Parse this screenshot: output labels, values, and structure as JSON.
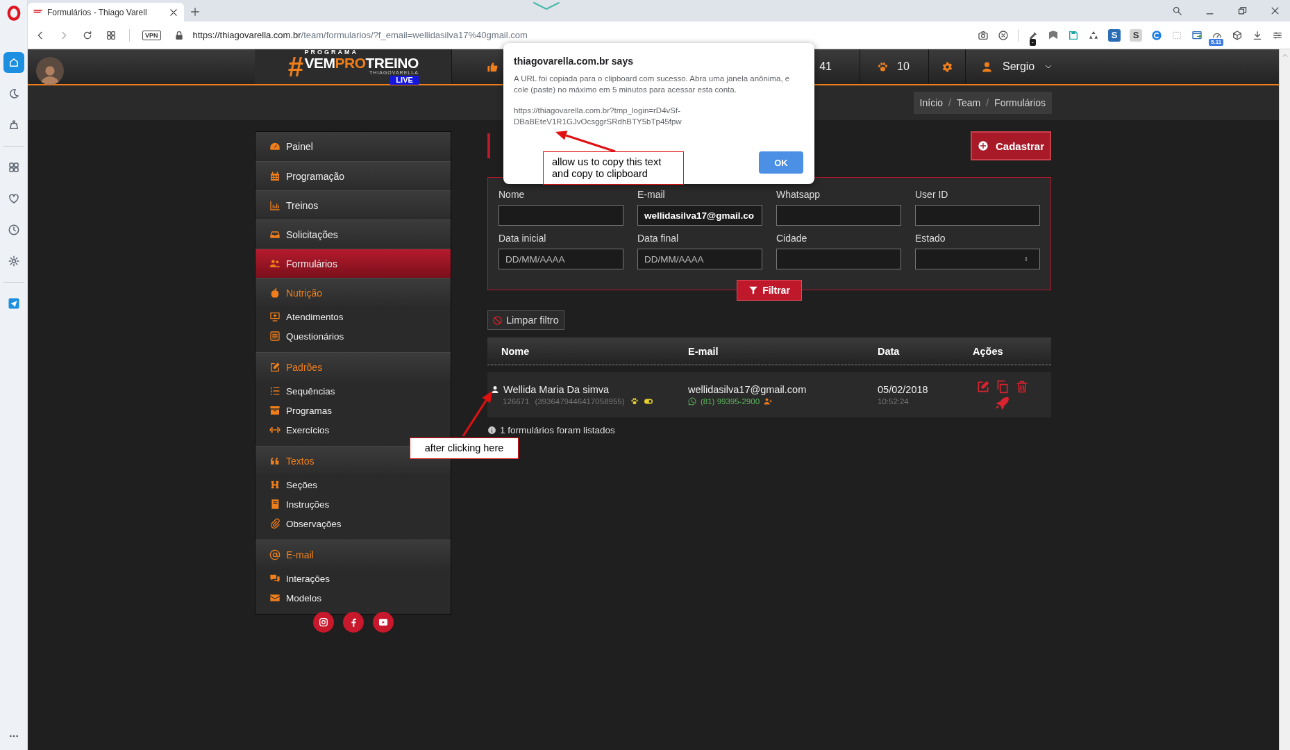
{
  "browser": {
    "tabs": [
      {
        "title": "Formulários - Thiago Varell",
        "selected": true
      }
    ],
    "side_panel": {
      "groups": [
        {
          "items": [
            {
              "kind": "home",
              "selected": true
            },
            {
              "kind": "crescent",
              "selected": false
            },
            {
              "kind": "bag",
              "selected": false
            }
          ]
        },
        {
          "items": [
            {
              "kind": "grid",
              "selected": false
            },
            {
              "kind": "heart",
              "selected": false
            },
            {
              "kind": "clock",
              "selected": false
            },
            {
              "kind": "settings",
              "selected": false
            }
          ]
        },
        {
          "items": [
            {
              "kind": "send",
              "selected": false
            }
          ]
        }
      ]
    },
    "vpn_badge": "VPN",
    "url": {
      "host": "https://thiagovarella.com.br",
      "path": "/team/formularios/?f_email=wellidasilva17%40gmail.com"
    },
    "extensions": [
      {
        "kind": "camera"
      },
      {
        "kind": "blocker"
      },
      {
        "kind": "eyedropper",
        "badge": "-"
      },
      {
        "kind": "bookmark"
      },
      {
        "kind": "floppy"
      },
      {
        "kind": "recycle"
      },
      {
        "kind": "letter",
        "label": "S",
        "color": "#2a6db5"
      },
      {
        "kind": "letter",
        "label": "S",
        "color": "#d4d4d4"
      },
      {
        "kind": "refresh"
      },
      {
        "kind": "snapshot"
      },
      {
        "kind": "window"
      },
      {
        "kind": "speed",
        "badge": "5.11"
      },
      {
        "kind": "cube"
      },
      {
        "kind": "download"
      },
      {
        "kind": "easy_setup"
      }
    ]
  },
  "header": {
    "logo": {
      "kicker": "PROGRAMA",
      "hash": "#",
      "words": [
        {
          "text": "VEM",
          "color": "#ffffff"
        },
        {
          "text": "PRO",
          "color": "#f07f1b"
        },
        {
          "text": "TREINO",
          "color": "#ffffff"
        }
      ],
      "byline": "THIAGOVARELLA",
      "badge": "LIVE"
    },
    "stats": [
      {
        "kind": "likes",
        "value": "41"
      },
      {
        "kind": "paw",
        "value": "10"
      }
    ],
    "user": {
      "name": "Sergio"
    }
  },
  "breadcrumb": [
    {
      "kind": "link",
      "text": "Início"
    },
    {
      "kind": "separator",
      "text": "/"
    },
    {
      "kind": "link",
      "text": "Team"
    },
    {
      "kind": "separator",
      "text": "/"
    },
    {
      "kind": "current",
      "text": "Formulários"
    }
  ],
  "sidebar": {
    "items": [
      {
        "label": "Painel",
        "kind": "link",
        "selected": false
      },
      {
        "label": "Programação",
        "kind": "link",
        "selected": false
      },
      {
        "label": "Treinos",
        "kind": "link",
        "selected": false
      },
      {
        "label": "Solicitações",
        "kind": "link",
        "selected": false
      },
      {
        "label": "Formulários",
        "kind": "link",
        "selected": true
      },
      {
        "label": "Nutrição",
        "kind": "group",
        "selected": false,
        "children": [
          {
            "label": "Atendimentos",
            "selected": false
          },
          {
            "label": "Questionários",
            "selected": false
          }
        ]
      },
      {
        "label": "Padrões",
        "kind": "group",
        "selected": false,
        "children": [
          {
            "label": "Sequências",
            "selected": false
          },
          {
            "label": "Programas",
            "selected": false
          },
          {
            "label": "Exercícios",
            "selected": false
          }
        ]
      },
      {
        "label": "Textos",
        "kind": "group",
        "selected": false,
        "children": [
          {
            "label": "Seções",
            "selected": false
          },
          {
            "label": "Instruções",
            "selected": false
          },
          {
            "label": "Observações",
            "selected": false
          }
        ]
      },
      {
        "label": "E-mail",
        "kind": "group",
        "selected": false,
        "children": [
          {
            "label": "Interações",
            "selected": false
          },
          {
            "label": "Modelos",
            "selected": false
          }
        ]
      }
    ],
    "social": [
      {
        "kind": "instagram"
      },
      {
        "kind": "facebook"
      },
      {
        "kind": "youtube"
      }
    ]
  },
  "cadastrar_button": "Cadastrar",
  "filters": [
    {
      "label": "Nome",
      "kind": "text"
    },
    {
      "label": "E-mail",
      "kind": "text",
      "value": "wellidasilva17@gmail.co"
    },
    {
      "label": "Whatsapp",
      "kind": "text"
    },
    {
      "label": "User ID",
      "kind": "text"
    },
    {
      "label": "Data inicial",
      "kind": "text",
      "placeholder": "DD/MM/AAAA"
    },
    {
      "label": "Data final",
      "kind": "text",
      "placeholder": "DD/MM/AAAA"
    },
    {
      "label": "Cidade",
      "kind": "text"
    },
    {
      "label": "Estado",
      "kind": "select"
    }
  ],
  "filter_button": "Filtrar",
  "clear_button": "Limpar filtro",
  "table": {
    "columns": [
      "Nome",
      "E-mail",
      "Data",
      "Ações"
    ],
    "rows": [
      {
        "name": "Wellida Maria Da simva",
        "user_id": "126671",
        "device_id": "(3936479446417058955)",
        "email": "wellidasilva17@gmail.com",
        "phone": "(81) 99395-2900",
        "date": "05/02/2018",
        "time": "10:52:24"
      }
    ]
  },
  "summary": "1 formulários foram listados",
  "dialog": {
    "title": "thiagovarella.com.br says",
    "message": "A URL foi copiada para o clipboard com sucesso. Abra uma janela anônima, e cole (paste) no máximo em 5 minutos para acessar esta conta.",
    "link": "https://thiagovarella.com.br?tmp_login=rD4vSf-DBaBEteV1R1GJvOcsggrSRdhBTY5bTp45fpw",
    "ok_button": "OK"
  },
  "annotations": [
    {
      "text": "allow us to copy this text and copy to clipboard"
    },
    {
      "text": "after clicking here"
    }
  ]
}
